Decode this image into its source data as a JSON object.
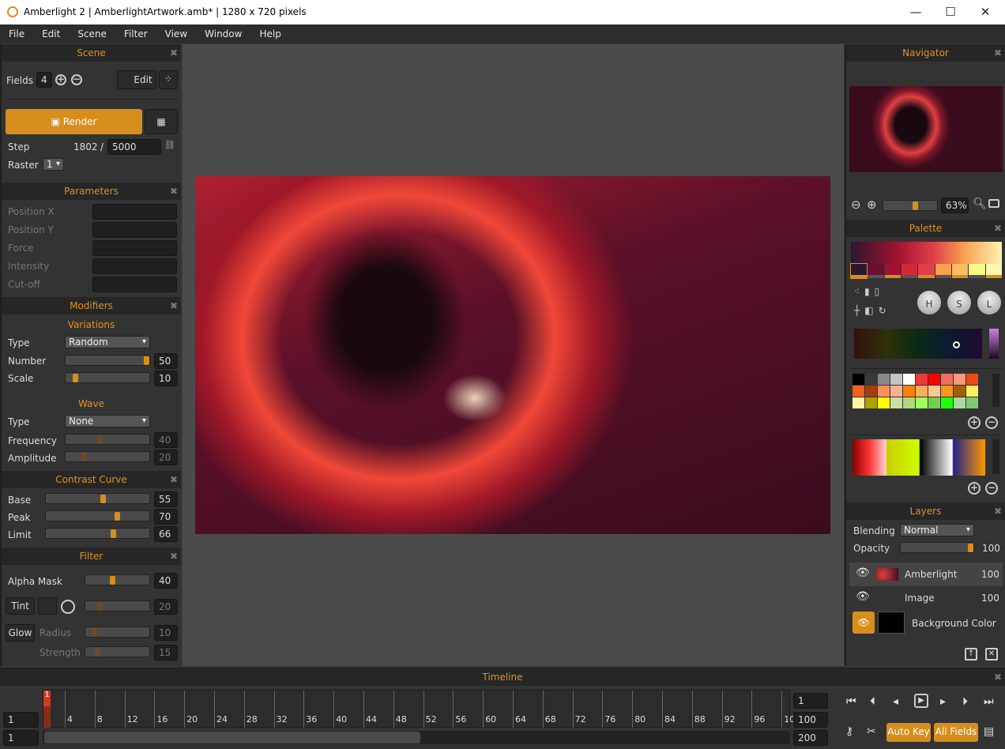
{
  "window": {
    "title": "Amberlight 2 | AmberlightArtwork.amb* | 1280 x 720 pixels",
    "minimize": "—",
    "maximize": "☐",
    "close": "✕"
  },
  "menu": [
    "File",
    "Edit",
    "Scene",
    "Filter",
    "View",
    "Window",
    "Help"
  ],
  "scene": {
    "title": "Scene",
    "fields_label": "Fields",
    "fields_value": "4",
    "edit_label": "Edit",
    "render_label": "Render",
    "step_label": "Step",
    "step_current": "1802",
    "step_sep": "/",
    "step_total": "5000",
    "raster_label": "Raster",
    "raster_value": "1"
  },
  "parameters": {
    "title": "Parameters",
    "items": [
      "Position X",
      "Position Y",
      "Force",
      "Intensity",
      "Cut-off"
    ]
  },
  "modifiers": {
    "title": "Modifiers",
    "variations_title": "Variations",
    "type_label": "Type",
    "type_value": "Random",
    "number_label": "Number",
    "number_value": "50",
    "number_level": 100,
    "scale_label": "Scale",
    "scale_value": "10",
    "scale_level": 10,
    "wave_title": "Wave",
    "wave_type_label": "Type",
    "wave_type_value": "None",
    "frequency_label": "Frequency",
    "frequency_value": "40",
    "frequency_level": 40,
    "amplitude_label": "Amplitude",
    "amplitude_value": "20",
    "amplitude_level": 20
  },
  "contrast": {
    "title": "Contrast Curve",
    "items": [
      {
        "label": "Base",
        "value": "55",
        "level": 55
      },
      {
        "label": "Peak",
        "value": "70",
        "level": 70
      },
      {
        "label": "Limit",
        "value": "66",
        "level": 66
      }
    ]
  },
  "filter": {
    "title": "Filter",
    "alpha_label": "Alpha Mask",
    "alpha_value": "40",
    "alpha_level": 40,
    "tint_label": "Tint",
    "tint_value": "20",
    "glow_label": "Glow",
    "radius_label": "Radius",
    "radius_value": "10",
    "strength_label": "Strength",
    "strength_value": "15"
  },
  "navigator": {
    "title": "Navigator",
    "zoom": "63%",
    "zoom_level": 63
  },
  "palette": {
    "title": "Palette",
    "h": "H",
    "s": "S",
    "l": "L",
    "stops": [
      "#2a1830",
      "#6a0f30",
      "#a01030",
      "#d02a3a",
      "#e04048",
      "#f8a050",
      "#fcbc60",
      "#f8f888",
      "#fff4b0"
    ],
    "swatches": [
      "#000000",
      "#3a3a3a",
      "#888888",
      "#c4c4c4",
      "#ffffff",
      "#e83a3a",
      "#ff0000",
      "#f07060",
      "#f49a80",
      "#f04818",
      "#f06020",
      "#a04010",
      "#f89060",
      "#f8b090",
      "#ff8000",
      "#f8b060",
      "#fcc890",
      "#f89820",
      "#a06008",
      "#fcf060",
      "#fff4a0",
      "#b0a000",
      "#ffff00",
      "#c8e0a0",
      "#b0d880",
      "#a0ff60",
      "#70d050",
      "#20ff00",
      "#a8d8a0",
      "#80c878"
    ]
  },
  "layers": {
    "title": "Layers",
    "blending_label": "Blending",
    "blending_value": "Normal",
    "opacity_label": "Opacity",
    "opacity_value": "100",
    "opacity_level": 100,
    "items": [
      {
        "name": "Amberlight",
        "value": "100"
      },
      {
        "name": "Image",
        "value": "100"
      },
      {
        "name": "Background Color",
        "value": ""
      }
    ]
  },
  "timeline": {
    "title": "Timeline",
    "marker": "1",
    "ticks": [
      "4",
      "8",
      "12",
      "16",
      "20",
      "24",
      "28",
      "32",
      "36",
      "40",
      "44",
      "48",
      "52",
      "56",
      "60",
      "64",
      "68",
      "72",
      "76",
      "80",
      "84",
      "88",
      "92",
      "96",
      "10"
    ],
    "left_value1": "1",
    "left_value2": "1",
    "right_current": "1",
    "right_end": "100",
    "right_total": "200",
    "auto_key": "Auto Key",
    "all_fields": "All Fields"
  },
  "colors": {
    "accent": "#d88e1c",
    "panel": "#333333",
    "header_text": "#e0921e"
  }
}
